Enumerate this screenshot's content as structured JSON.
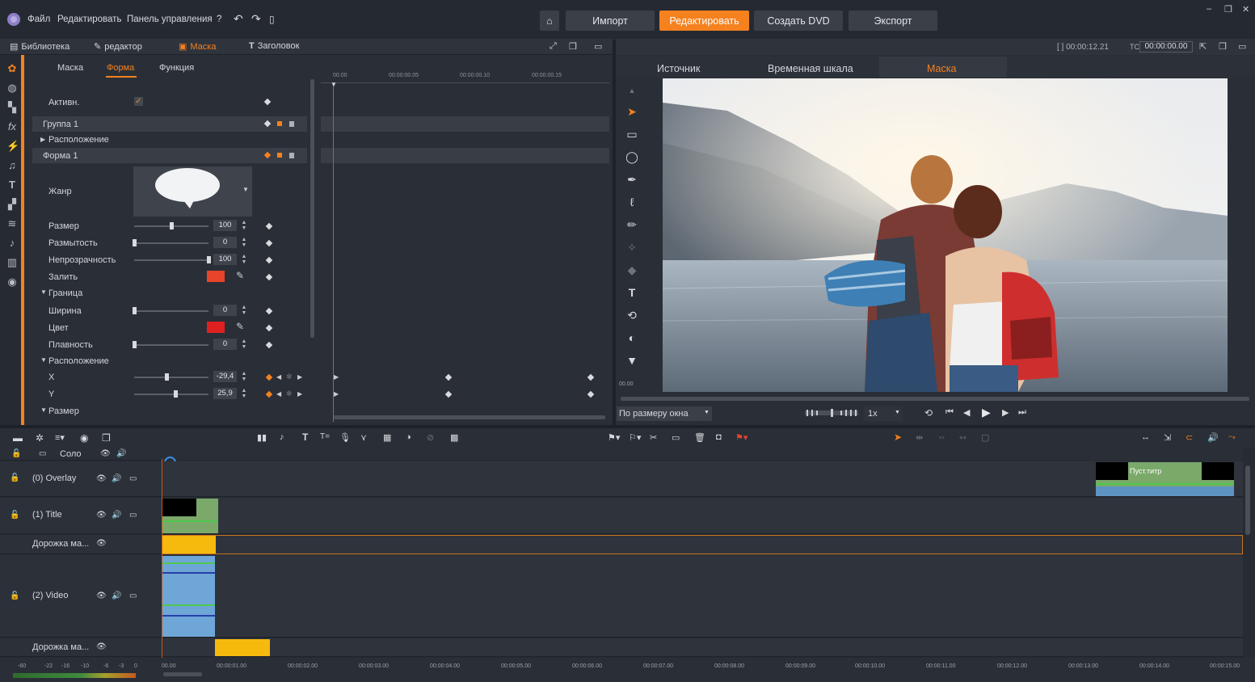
{
  "menu": {
    "file": "Файл",
    "edit": "Редактировать",
    "control_panel": "Панель управления",
    "help": "?"
  },
  "nav": {
    "import": "Импорт",
    "edit": "Редактировать",
    "dvd": "Создать DVD",
    "export": "Экспорт"
  },
  "library_tabs": {
    "library": "Библиотека",
    "editor": "редактор",
    "mask": "Маска",
    "title": "Заголовок"
  },
  "sub_tabs": {
    "mask": "Маска",
    "shape": "Форма",
    "function": "Функция"
  },
  "props": {
    "active": "Активн.",
    "group": "Группа 1",
    "placement": "Расположение",
    "shape": "Форма 1",
    "genre": "Жанр",
    "size": "Размер",
    "size_val": "100",
    "blur": "Размытость",
    "blur_val": "0",
    "opacity": "Непрозрачность",
    "opacity_val": "100",
    "fill": "Залить",
    "border": "Граница",
    "width": "Ширина",
    "width_val": "0",
    "color": "Цвет",
    "smooth": "Плавность",
    "smooth_val": "0",
    "placement2": "Расположение",
    "x": "X",
    "x_val": "-29,4",
    "y": "Y",
    "y_val": "25,9",
    "size2": "Размер"
  },
  "kf_ruler": [
    "00.00",
    "00:00:00.05",
    "00:00:00.10",
    "00:00:00.15"
  ],
  "preview": {
    "duration": "[ ] 00:00:12.21",
    "tc_label": "TC",
    "tc": "00:00:00.00",
    "tabs": {
      "source": "Источник",
      "timeline": "Временная шкала",
      "mask": "Маска"
    },
    "fit": "По размеру окна",
    "speed": "1x",
    "ruler_start": "00.00"
  },
  "tracks": {
    "solo": "Соло",
    "overlay": "(0) Overlay",
    "title": "(1) Title",
    "mask_track1": "Дорожка ма...",
    "video": "(2) Video",
    "mask_track2": "Дорожка ма...",
    "clip_title": "Пуст.титр"
  },
  "timeline_ticks": [
    "00.00",
    "00:00:01.00",
    "00:00:02.00",
    "00:00:03.00",
    "00:00:04.00",
    "00:00:05.00",
    "00:00:06.00",
    "00:00:07.00",
    "00:00:08.00",
    "00:00:09.00",
    "00:00:10.00",
    "00:00:11.00",
    "00:00:12.00",
    "00:00:13.00",
    "00:00:14.00",
    "00:00:15.00"
  ],
  "audio_scale": [
    "-60",
    "-22",
    "-16",
    "-10",
    "-6",
    "-3",
    "0"
  ],
  "colors": {
    "accent": "#f5811f",
    "fill_color": "#e8432b",
    "border_color": "#e02020",
    "mask_clip": "#f6b90e",
    "title_clip": "#7aa96a",
    "video_clip": "#6fa6d8"
  }
}
